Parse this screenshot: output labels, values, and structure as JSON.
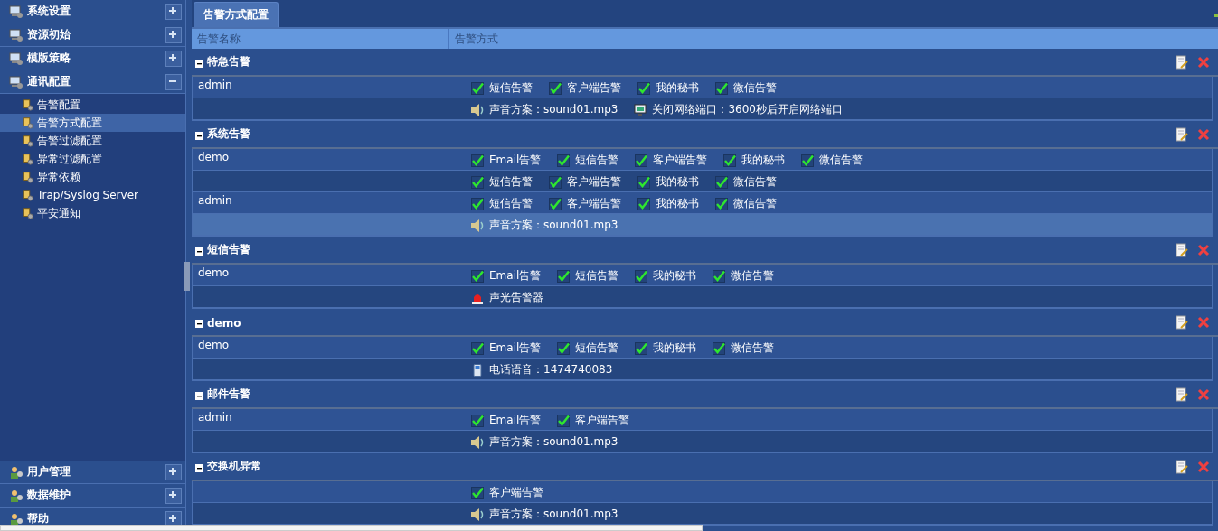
{
  "sidebar": {
    "sections": [
      {
        "label": "系统设置",
        "expanded": false
      },
      {
        "label": "资源初始",
        "expanded": false
      },
      {
        "label": "模版策略",
        "expanded": false
      },
      {
        "label": "通讯配置",
        "expanded": true,
        "children": [
          {
            "label": "告警配置",
            "selected": false
          },
          {
            "label": "告警方式配置",
            "selected": true
          },
          {
            "label": "告警过滤配置",
            "selected": false
          },
          {
            "label": "异常过滤配置",
            "selected": false
          },
          {
            "label": "异常依赖",
            "selected": false
          },
          {
            "label": "Trap/Syslog Server",
            "selected": false
          },
          {
            "label": "平安通知",
            "selected": false
          }
        ]
      }
    ],
    "bottom_sections": [
      {
        "label": "用户管理",
        "expanded": false
      },
      {
        "label": "数据维护",
        "expanded": false
      },
      {
        "label": "帮助",
        "expanded": false
      }
    ]
  },
  "tabs": [
    {
      "label": "告警方式配置",
      "selected": true
    }
  ],
  "table": {
    "columns": [
      "告警名称",
      "告警方式"
    ],
    "groups": [
      {
        "title": "特急告警",
        "expanded": true,
        "rows": [
          {
            "name": "admin",
            "selected": false,
            "methods": [
              {
                "kind": "check",
                "label": "短信告警",
                "checked": true
              },
              {
                "kind": "check",
                "label": "客户端告警",
                "checked": true
              },
              {
                "kind": "check",
                "label": "我的秘书",
                "checked": true
              },
              {
                "kind": "check",
                "label": "微信告警",
                "checked": true
              }
            ]
          },
          {
            "selected": false,
            "methods": [
              {
                "kind": "sound",
                "label": "声音方案：sound01.mp3"
              },
              {
                "kind": "network",
                "label": "关闭网络端口：3600秒后开启网络端口"
              }
            ]
          }
        ]
      },
      {
        "title": "系统告警",
        "expanded": true,
        "rows": [
          {
            "name": "demo",
            "selected": false,
            "methods": [
              {
                "kind": "check",
                "label": "Email告警",
                "checked": true
              },
              {
                "kind": "check",
                "label": "短信告警",
                "checked": true
              },
              {
                "kind": "check",
                "label": "客户端告警",
                "checked": true
              },
              {
                "kind": "check",
                "label": "我的秘书",
                "checked": true
              },
              {
                "kind": "check",
                "label": "微信告警",
                "checked": true
              }
            ]
          },
          {
            "selected": false,
            "methods": [
              {
                "kind": "check",
                "label": "短信告警",
                "checked": true
              },
              {
                "kind": "check",
                "label": "客户端告警",
                "checked": true
              },
              {
                "kind": "check",
                "label": "我的秘书",
                "checked": true
              },
              {
                "kind": "check",
                "label": "微信告警",
                "checked": true
              }
            ]
          },
          {
            "name": "admin",
            "selected": false,
            "methods": [
              {
                "kind": "check",
                "label": "短信告警",
                "checked": true
              },
              {
                "kind": "check",
                "label": "客户端告警",
                "checked": true
              },
              {
                "kind": "check",
                "label": "我的秘书",
                "checked": true
              },
              {
                "kind": "check",
                "label": "微信告警",
                "checked": true
              }
            ]
          },
          {
            "selected": true,
            "methods": [
              {
                "kind": "sound",
                "label": "声音方案：sound01.mp3"
              }
            ]
          }
        ]
      },
      {
        "title": "短信告警",
        "expanded": true,
        "rows": [
          {
            "name": "demo",
            "selected": false,
            "methods": [
              {
                "kind": "check",
                "label": "Email告警",
                "checked": true
              },
              {
                "kind": "check",
                "label": "短信告警",
                "checked": true
              },
              {
                "kind": "check",
                "label": "我的秘书",
                "checked": true
              },
              {
                "kind": "check",
                "label": "微信告警",
                "checked": true
              }
            ]
          },
          {
            "selected": false,
            "methods": [
              {
                "kind": "siren",
                "label": "声光告警器"
              }
            ]
          }
        ]
      },
      {
        "title": "demo",
        "expanded": true,
        "rows": [
          {
            "name": "demo",
            "selected": false,
            "methods": [
              {
                "kind": "check",
                "label": "Email告警",
                "checked": true
              },
              {
                "kind": "check",
                "label": "短信告警",
                "checked": true
              },
              {
                "kind": "check",
                "label": "我的秘书",
                "checked": true
              },
              {
                "kind": "check",
                "label": "微信告警",
                "checked": true
              }
            ]
          },
          {
            "selected": false,
            "methods": [
              {
                "kind": "phone",
                "label": "电话语音：1474740083"
              }
            ]
          }
        ]
      },
      {
        "title": "邮件告警",
        "expanded": true,
        "rows": [
          {
            "name": "admin",
            "selected": false,
            "methods": [
              {
                "kind": "check",
                "label": "Email告警",
                "checked": true
              },
              {
                "kind": "check",
                "label": "客户端告警",
                "checked": true
              }
            ]
          },
          {
            "selected": false,
            "methods": [
              {
                "kind": "sound",
                "label": "声音方案：sound01.mp3"
              }
            ]
          }
        ]
      },
      {
        "title": "交换机异常",
        "expanded": true,
        "rows": [
          {
            "selected": false,
            "methods": [
              {
                "kind": "check",
                "label": "客户端告警",
                "checked": true
              }
            ]
          },
          {
            "selected": false,
            "methods": [
              {
                "kind": "sound",
                "label": "声音方案：sound01.mp3"
              }
            ]
          }
        ]
      }
    ]
  }
}
